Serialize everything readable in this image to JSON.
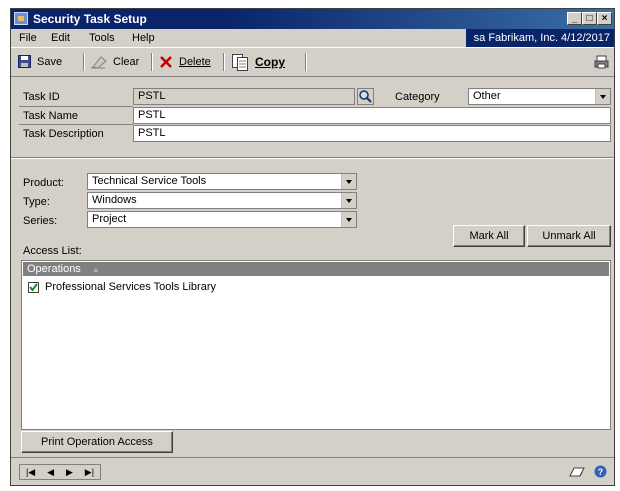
{
  "window": {
    "title": "Security Task Setup",
    "user_info": "sa  Fabrikam, Inc.  4/12/2017"
  },
  "menu": {
    "file": "File",
    "edit": "Edit",
    "tools": "Tools",
    "help": "Help"
  },
  "toolbar": {
    "save": "Save",
    "clear": "Clear",
    "delete": "Delete",
    "copy": "Copy"
  },
  "task": {
    "task_id_label": "Task ID",
    "task_id_value": "PSTL",
    "category_label": "Category",
    "category_value": "Other",
    "task_name_label": "Task Name",
    "task_name_value": "PSTL",
    "task_description_label": "Task Description",
    "task_description_value": "PSTL"
  },
  "filters": {
    "product_label": "Product:",
    "product_value": "Technical Service Tools",
    "type_label": "Type:",
    "type_value": "Windows",
    "series_label": "Series:",
    "series_value": "Project"
  },
  "access": {
    "label": "Access List:",
    "mark_all": "Mark All",
    "unmark_all": "Unmark All",
    "column_header": "Operations",
    "items": [
      {
        "label": "Professional Services Tools Library",
        "checked": true
      }
    ]
  },
  "print_button": "Print Operation Access"
}
